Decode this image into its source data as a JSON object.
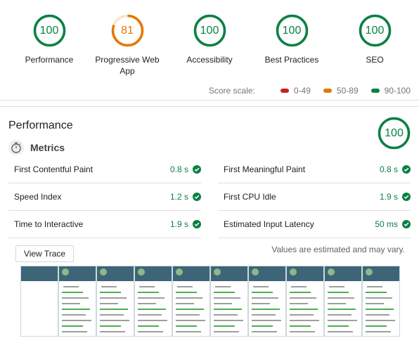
{
  "colors": {
    "pass": "#0b8043",
    "pass_ring": "#0b8043",
    "average": "#e67700",
    "fail": "#c7221f",
    "ring_track_pass": "#d7efdc",
    "ring_track_average": "#fde3cc"
  },
  "gauges": [
    {
      "score": "100",
      "label": "Performance",
      "status": "pass",
      "fraction": 1.0
    },
    {
      "score": "81",
      "label": "Progressive Web App",
      "status": "average",
      "fraction": 0.81
    },
    {
      "score": "100",
      "label": "Accessibility",
      "status": "pass",
      "fraction": 1.0
    },
    {
      "score": "100",
      "label": "Best Practices",
      "status": "pass",
      "fraction": 1.0
    },
    {
      "score": "100",
      "label": "SEO",
      "status": "pass",
      "fraction": 1.0
    }
  ],
  "scale": {
    "title": "Score scale:",
    "ranges": [
      {
        "label": "0-49",
        "color": "#c7221f"
      },
      {
        "label": "50-89",
        "color": "#e67700"
      },
      {
        "label": "90-100",
        "color": "#0b8043"
      }
    ]
  },
  "category": {
    "title": "Performance",
    "score": "100",
    "fraction": 1.0,
    "metrics_title": "Metrics",
    "metrics": [
      {
        "label": "First Contentful Paint",
        "value": "0.8 s"
      },
      {
        "label": "First Meaningful Paint",
        "value": "0.8 s"
      },
      {
        "label": "Speed Index",
        "value": "1.2 s"
      },
      {
        "label": "First CPU Idle",
        "value": "1.9 s"
      },
      {
        "label": "Time to Interactive",
        "value": "1.9 s"
      },
      {
        "label": "Estimated Input Latency",
        "value": "50 ms"
      }
    ],
    "view_trace": "View Trace",
    "estimate_note": "Values are estimated and may vary."
  },
  "filmstrip": {
    "frames": 10
  }
}
